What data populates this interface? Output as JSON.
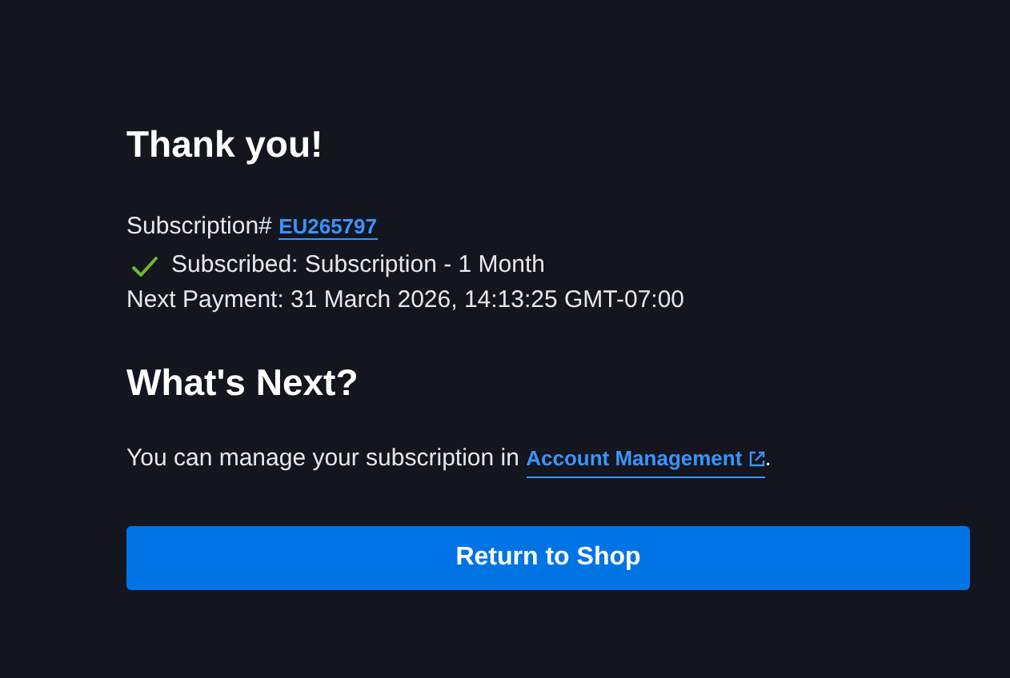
{
  "title": "Thank you!",
  "subscription": {
    "label": "Subscription#",
    "number": "EU265797"
  },
  "status": {
    "text": "Subscribed: Subscription - 1 Month",
    "subscribed": true
  },
  "next_payment": "Next Payment: 31 March 2026, 14:13:25 GMT-07:00",
  "next_heading": "What's Next?",
  "manage": {
    "text": "You can manage your subscription in",
    "link": "Account Management",
    "end": "."
  },
  "button": "Return to Shop"
}
